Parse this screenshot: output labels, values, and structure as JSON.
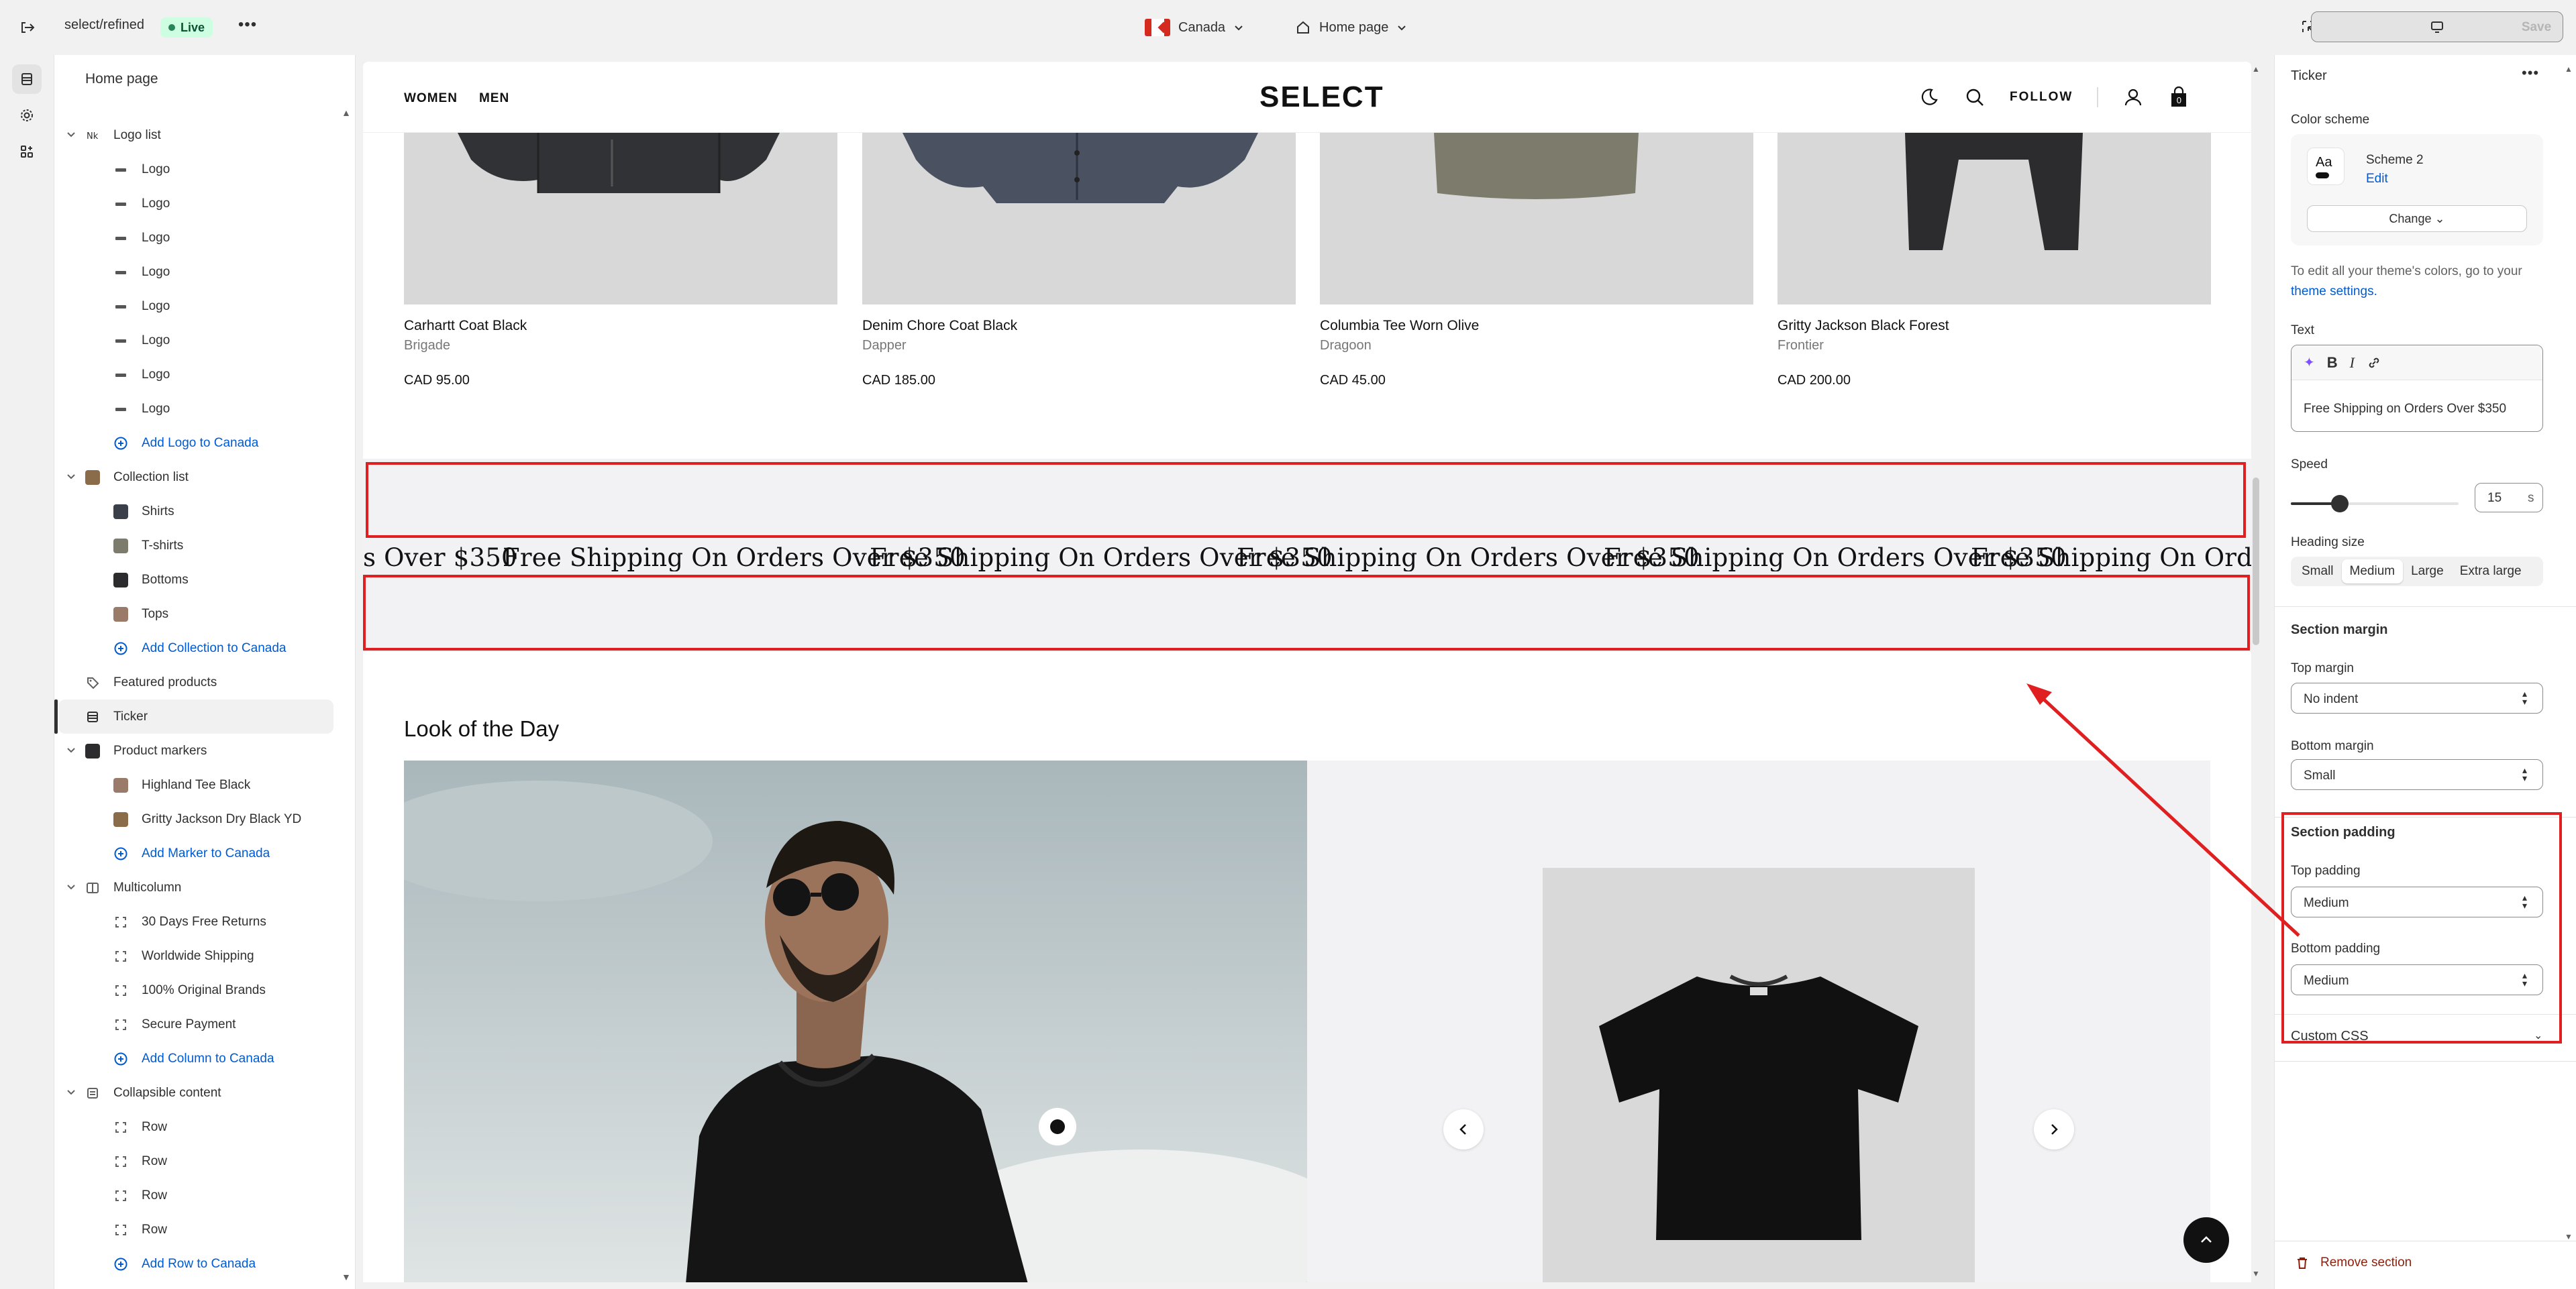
{
  "topbar": {
    "store": "select/refined",
    "status": "Live",
    "country": "Canada",
    "page": "Home page",
    "save_label": "Save"
  },
  "sidebar": {
    "title": "Home page",
    "items": [
      {
        "label": "Logo list",
        "level": 0,
        "icon": "logo-list-icon",
        "chev": true
      },
      {
        "label": "Logo",
        "level": 1,
        "icon": "logo-thumb-icon"
      },
      {
        "label": "Logo",
        "level": 1,
        "icon": "logo-thumb-icon"
      },
      {
        "label": "Logo",
        "level": 1,
        "icon": "logo-thumb-icon"
      },
      {
        "label": "Logo",
        "level": 1,
        "icon": "logo-thumb-icon"
      },
      {
        "label": "Logo",
        "level": 1,
        "icon": "logo-thumb-icon"
      },
      {
        "label": "Logo",
        "level": 1,
        "icon": "logo-thumb-icon"
      },
      {
        "label": "Logo",
        "level": 1,
        "icon": "logo-thumb-icon"
      },
      {
        "label": "Logo",
        "level": 1,
        "icon": "logo-thumb-icon"
      },
      {
        "label": "Add Logo to Canada",
        "level": 1,
        "icon": "add-circle-icon",
        "add": true
      },
      {
        "label": "Collection list",
        "level": 0,
        "icon": "collection-thumb-icon",
        "chev": true
      },
      {
        "label": "Shirts",
        "level": 1,
        "icon": "collection-thumb-icon"
      },
      {
        "label": "T-shirts",
        "level": 1,
        "icon": "collection-thumb-icon"
      },
      {
        "label": "Bottoms",
        "level": 1,
        "icon": "collection-thumb-icon"
      },
      {
        "label": "Tops",
        "level": 1,
        "icon": "collection-thumb-icon"
      },
      {
        "label": "Add Collection to Canada",
        "level": 1,
        "icon": "add-circle-icon",
        "add": true
      },
      {
        "label": "Featured products",
        "level": 0,
        "icon": "tag-icon"
      },
      {
        "label": "Ticker",
        "level": 0,
        "icon": "ticker-icon",
        "active": true
      },
      {
        "label": "Product markers",
        "level": 0,
        "icon": "product-thumb-icon",
        "chev": true
      },
      {
        "label": "Highland Tee Black",
        "level": 1,
        "icon": "product-thumb-icon"
      },
      {
        "label": "Gritty Jackson Dry Black YD",
        "level": 1,
        "icon": "product-thumb-icon"
      },
      {
        "label": "Add Marker to Canada",
        "level": 1,
        "icon": "add-circle-icon",
        "add": true
      },
      {
        "label": "Multicolumn",
        "level": 0,
        "icon": "columns-icon",
        "chev": true
      },
      {
        "label": "30 Days Free Returns",
        "level": 1,
        "icon": "block-frame-icon"
      },
      {
        "label": "Worldwide Shipping",
        "level": 1,
        "icon": "block-frame-icon"
      },
      {
        "label": "100% Original Brands",
        "level": 1,
        "icon": "block-frame-icon"
      },
      {
        "label": "Secure Payment",
        "level": 1,
        "icon": "block-frame-icon"
      },
      {
        "label": "Add Column to Canada",
        "level": 1,
        "icon": "add-circle-icon",
        "add": true
      },
      {
        "label": "Collapsible content",
        "level": 0,
        "icon": "collapsible-icon",
        "chev": true
      },
      {
        "label": "Row",
        "level": 1,
        "icon": "block-frame-icon"
      },
      {
        "label": "Row",
        "level": 1,
        "icon": "block-frame-icon"
      },
      {
        "label": "Row",
        "level": 1,
        "icon": "block-frame-icon"
      },
      {
        "label": "Row",
        "level": 1,
        "icon": "block-frame-icon"
      },
      {
        "label": "Add Row to Canada",
        "level": 1,
        "icon": "add-circle-icon",
        "add": true
      }
    ]
  },
  "store": {
    "nav": [
      "WOMEN",
      "MEN"
    ],
    "logo": "SELECT",
    "follow": "FOLLOW",
    "cart_count": "0",
    "products": [
      {
        "name": "Carhartt Coat Black",
        "brand": "Brigade",
        "price": "CAD 95.00"
      },
      {
        "name": "Denim Chore Coat Black",
        "brand": "Dapper",
        "price": "CAD 185.00"
      },
      {
        "name": "Columbia Tee Worn Olive",
        "brand": "Dragoon",
        "price": "CAD 45.00"
      },
      {
        "name": "Gritty Jackson Black Forest",
        "brand": "Frontier",
        "price": "CAD 200.00"
      }
    ],
    "ticker_partial": "s Over $350",
    "ticker_text": "Free Shipping On Orders Over $350",
    "ticker_trailing": "Free Shipping On Orders Ove",
    "lotd_title": "Look of the Day"
  },
  "panel": {
    "title": "Ticker",
    "color_scheme_label": "Color scheme",
    "scheme_name": "Scheme 2",
    "scheme_swatch": "Aa",
    "edit": "Edit",
    "change": "Change",
    "help_text": "To edit all your theme's colors, go to your",
    "help_link": "theme settings.",
    "text_label": "Text",
    "text_value": "Free Shipping on Orders Over $350",
    "speed_label": "Speed",
    "speed_value": "15",
    "speed_unit": "s",
    "speed_fraction": 0.29,
    "heading_size_label": "Heading size",
    "heading_sizes": [
      "Small",
      "Medium",
      "Large",
      "Extra large"
    ],
    "heading_size_selected": "Medium",
    "section_margin": "Section margin",
    "top_margin_label": "Top margin",
    "top_margin": "No indent",
    "bottom_margin_label": "Bottom margin",
    "bottom_margin": "Small",
    "section_padding": "Section padding",
    "top_padding_label": "Top padding",
    "top_padding": "Medium",
    "bottom_padding_label": "Bottom padding",
    "bottom_padding": "Medium",
    "custom_css": "Custom CSS",
    "remove": "Remove section"
  },
  "colors": {
    "annotation": "#e02020",
    "link": "#005bd3",
    "danger": "#8e1f0b"
  }
}
